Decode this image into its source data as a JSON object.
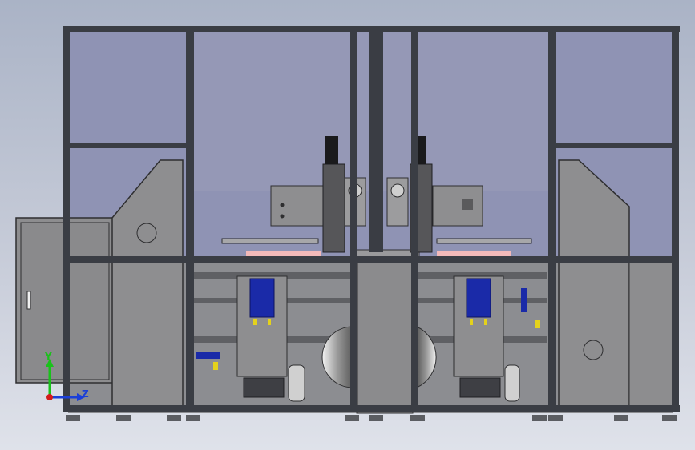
{
  "viewport": {
    "background_top": "#aab3c6",
    "background_bottom": "#dfe2ea"
  },
  "model": {
    "frame_color": "#3a3d44",
    "panel_color": "#8f8f91",
    "glass_color": "#8f93b4",
    "accent_blue": "#1a2aa8",
    "accent_yellow": "#e4d21b",
    "accent_pink": "#f3b9b9"
  },
  "triad": {
    "y_label": "Y",
    "z_label": "Z",
    "y_color": "#19c21a",
    "z_color": "#1b3fd8",
    "x_color": "#d41a1a"
  }
}
